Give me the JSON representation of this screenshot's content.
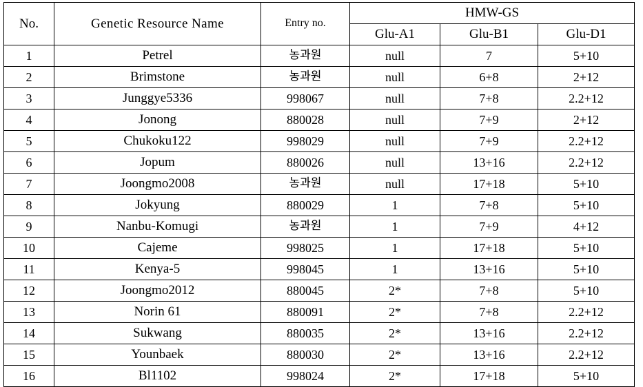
{
  "table": {
    "header": {
      "no": "No.",
      "name": "Genetic Resource Name",
      "entry": "Entry no.",
      "group": "HMW-GS",
      "sub": [
        "Glu-A1",
        "Glu-B1",
        "Glu-D1"
      ]
    },
    "columns": [
      "No.",
      "Genetic Resource Name",
      "Entry no.",
      "Glu-A1",
      "Glu-B1",
      "Glu-D1"
    ],
    "rows": [
      {
        "no": "1",
        "name": "Petrel",
        "entry": "농과원",
        "entry_korean": true,
        "a1": "null",
        "b1": "7",
        "d1": "5+10"
      },
      {
        "no": "2",
        "name": "Brimstone",
        "entry": "농과원",
        "entry_korean": true,
        "a1": "null",
        "b1": "6+8",
        "d1": "2+12"
      },
      {
        "no": "3",
        "name": "Junggye5336",
        "entry": "998067",
        "entry_korean": false,
        "a1": "null",
        "b1": "7+8",
        "d1": "2.2+12"
      },
      {
        "no": "4",
        "name": "Jonong",
        "entry": "880028",
        "entry_korean": false,
        "a1": "null",
        "b1": "7+9",
        "d1": "2+12"
      },
      {
        "no": "5",
        "name": "Chukoku122",
        "entry": "998029",
        "entry_korean": false,
        "a1": "null",
        "b1": "7+9",
        "d1": "2.2+12"
      },
      {
        "no": "6",
        "name": "Jopum",
        "entry": "880026",
        "entry_korean": false,
        "a1": "null",
        "b1": "13+16",
        "d1": "2.2+12"
      },
      {
        "no": "7",
        "name": "Joongmo2008",
        "entry": "농과원",
        "entry_korean": true,
        "a1": "null",
        "b1": "17+18",
        "d1": "5+10"
      },
      {
        "no": "8",
        "name": "Jokyung",
        "entry": "880029",
        "entry_korean": false,
        "a1": "1",
        "b1": "7+8",
        "d1": "5+10"
      },
      {
        "no": "9",
        "name": "Nanbu-Komugi",
        "entry": "농과원",
        "entry_korean": true,
        "a1": "1",
        "b1": "7+9",
        "d1": "4+12"
      },
      {
        "no": "10",
        "name": "Cajeme",
        "entry": "998025",
        "entry_korean": false,
        "a1": "1",
        "b1": "17+18",
        "d1": "5+10"
      },
      {
        "no": "11",
        "name": "Kenya-5",
        "entry": "998045",
        "entry_korean": false,
        "a1": "1",
        "b1": "13+16",
        "d1": "5+10"
      },
      {
        "no": "12",
        "name": "Joongmo2012",
        "entry": "880045",
        "entry_korean": false,
        "a1": "2*",
        "b1": "7+8",
        "d1": "5+10"
      },
      {
        "no": "13",
        "name": "Norin 61",
        "entry": "880091",
        "entry_korean": false,
        "a1": "2*",
        "b1": "7+8",
        "d1": "2.2+12"
      },
      {
        "no": "14",
        "name": "Sukwang",
        "entry": "880035",
        "entry_korean": false,
        "a1": "2*",
        "b1": "13+16",
        "d1": "2.2+12"
      },
      {
        "no": "15",
        "name": "Younbaek",
        "entry": "880030",
        "entry_korean": false,
        "a1": "2*",
        "b1": "13+16",
        "d1": "2.2+12"
      },
      {
        "no": "16",
        "name": "Bl1102",
        "entry": "998024",
        "entry_korean": false,
        "a1": "2*",
        "b1": "17+18",
        "d1": "5+10"
      }
    ]
  },
  "colors": {
    "border": "#000000",
    "text": "#000000",
    "background": "#ffffff"
  }
}
